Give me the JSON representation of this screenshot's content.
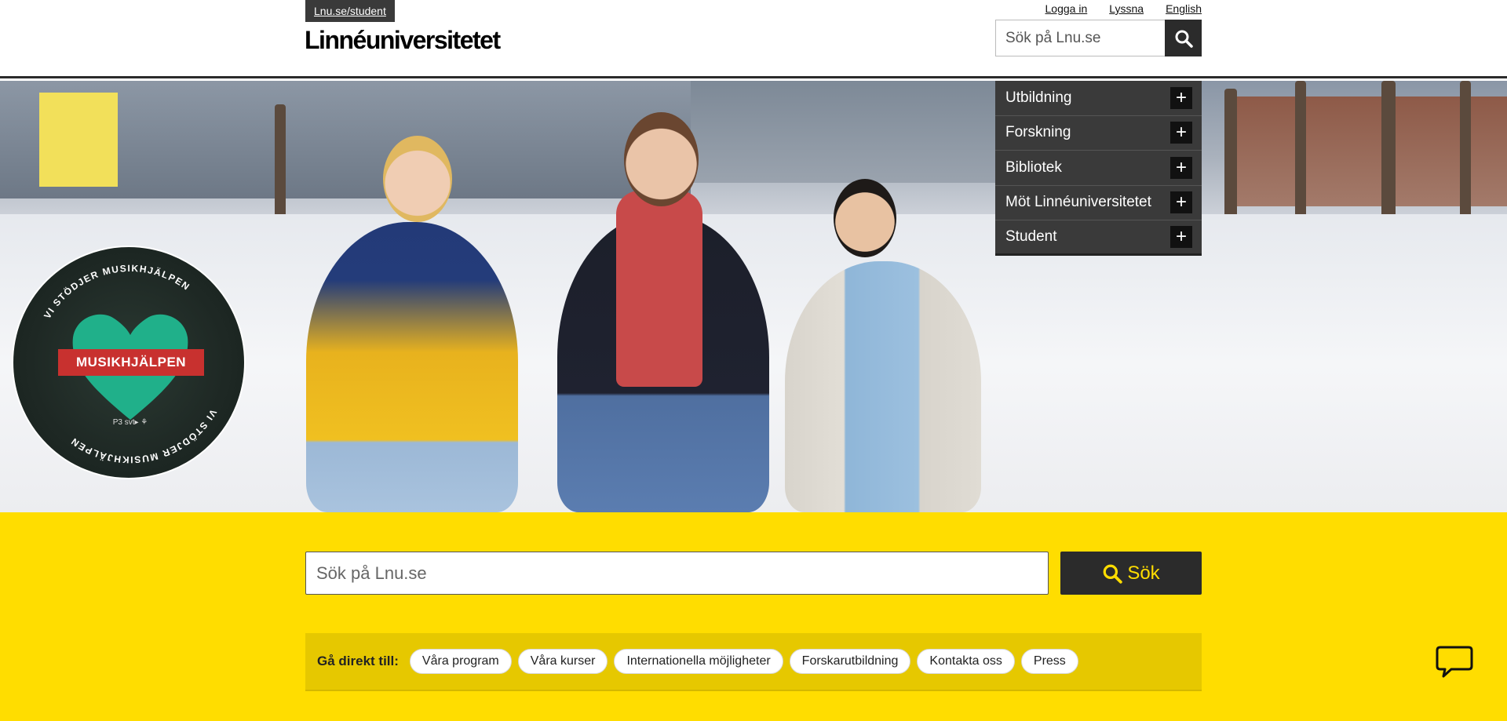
{
  "header": {
    "student_link": "Lnu.se/student",
    "logo": "Linnéuniversitetet",
    "links": [
      "Logga in",
      "Lyssna",
      "English"
    ],
    "search_placeholder": "Sök på Lnu.se",
    "search_icon": "search-icon"
  },
  "menu": {
    "items": [
      {
        "label": "Utbildning",
        "icon": "plus-icon"
      },
      {
        "label": "Forskning",
        "icon": "plus-icon"
      },
      {
        "label": "Bibliotek",
        "icon": "plus-icon"
      },
      {
        "label": "Möt Linnéuniversitetet",
        "icon": "plus-icon"
      },
      {
        "label": "Student",
        "icon": "plus-icon"
      }
    ]
  },
  "badge": {
    "ring_text": "VI STÖDJER MUSIKHJÄLPEN",
    "label": "MUSIKHJÄLPEN",
    "sponsors": "P3  svt▸  ⚘"
  },
  "main_search": {
    "placeholder": "Sök på Lnu.se",
    "button": "Sök"
  },
  "quick_links": {
    "label": "Gå direkt till:",
    "items": [
      "Våra program",
      "Våra kurser",
      "Internationella möjligheter",
      "Forskarutbildning",
      "Kontakta oss",
      "Press"
    ]
  },
  "colors": {
    "accent_yellow": "#ffdd00",
    "dark": "#2b2b2b",
    "badge_red": "#c8312f",
    "badge_heart": "#20b08a"
  },
  "icons": {
    "chat": "chat-bubble-icon",
    "search": "search-icon",
    "plus": "plus-icon"
  }
}
